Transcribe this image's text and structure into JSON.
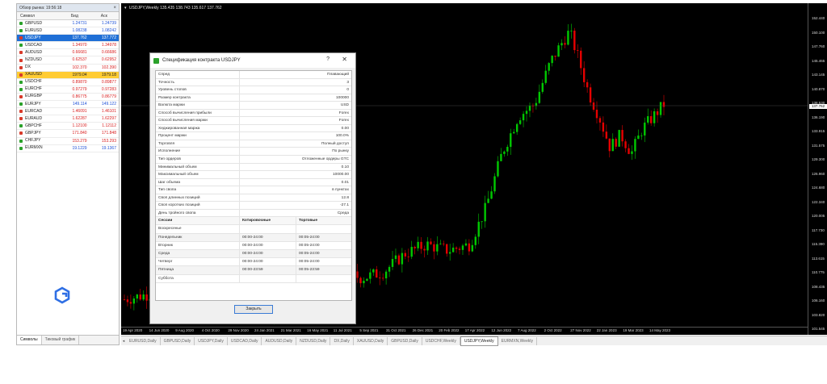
{
  "colors": {
    "bull": "#00c800",
    "bear": "#e60000",
    "selection": "#1f6fd6",
    "highlight": "#ffcc33"
  },
  "market_watch": {
    "title": "Обзор рынка: 19:56:18",
    "columns": [
      "Символ",
      "Бид",
      "Аск"
    ],
    "rows": [
      {
        "symbol": "GBPUSD",
        "bid": "1.24731",
        "ask": "1.24739",
        "color": "blue",
        "icon": "green"
      },
      {
        "symbol": "EURUSD",
        "bid": "1.08238",
        "ask": "1.08242",
        "color": "blue",
        "icon": "green"
      },
      {
        "symbol": "USDJPY",
        "bid": "137.762",
        "ask": "137.772",
        "color": "blue",
        "icon": "red",
        "state": "selected"
      },
      {
        "symbol": "USDCAD",
        "bid": "1.34970",
        "ask": "1.34978",
        "color": "red",
        "icon": "green"
      },
      {
        "symbol": "AUDUSD",
        "bid": "0.66681",
        "ask": "0.66686",
        "color": "red",
        "icon": "red"
      },
      {
        "symbol": "NZDUSD",
        "bid": "0.62537",
        "ask": "0.62952",
        "color": "red",
        "icon": "red"
      },
      {
        "symbol": "DX",
        "bid": "102.370",
        "ask": "102.390",
        "color": "red",
        "icon": "red"
      },
      {
        "symbol": "XAUUSD",
        "bid": "1979.04",
        "ask": "1979.18",
        "color": "red",
        "icon": "red",
        "state": "highlight"
      },
      {
        "symbol": "USDCHF",
        "bid": "0.89870",
        "ask": "0.89877",
        "color": "red",
        "icon": "green"
      },
      {
        "symbol": "EURCHF",
        "bid": "0.97279",
        "ask": "0.97283",
        "color": "red",
        "icon": "green"
      },
      {
        "symbol": "EURGBP",
        "bid": "0.86775",
        "ask": "0.86779",
        "color": "red",
        "icon": "red"
      },
      {
        "symbol": "EURJPY",
        "bid": "149.114",
        "ask": "149.122",
        "color": "blue",
        "icon": "green"
      },
      {
        "symbol": "EURCAD",
        "bid": "1.46091",
        "ask": "1.46101",
        "color": "red",
        "icon": "red"
      },
      {
        "symbol": "EURAUD",
        "bid": "1.62287",
        "ask": "1.62297",
        "color": "red",
        "icon": "red"
      },
      {
        "symbol": "GBPCHF",
        "bid": "1.12100",
        "ask": "1.12112",
        "color": "red",
        "icon": "green"
      },
      {
        "symbol": "GBPJPY",
        "bid": "171.840",
        "ask": "171.848",
        "color": "red",
        "icon": "red"
      },
      {
        "symbol": "CHFJPY",
        "bid": "153.279",
        "ask": "153.293",
        "color": "red",
        "icon": "green"
      },
      {
        "symbol": "EURMXN",
        "bid": "19.1229",
        "ask": "19.1367",
        "color": "blue",
        "icon": "green"
      }
    ],
    "tabs": [
      "Символы",
      "Тиковый график"
    ]
  },
  "chart": {
    "info": "USDJPY,Weekly  135.435  138.743  135.617  137.762",
    "current_price": "137.762",
    "price_labels": [
      "152.440",
      "150.100",
      "147.760",
      "145.465",
      "143.145",
      "140.870",
      "138.530",
      "136.190",
      "133.915",
      "131.575",
      "129.300",
      "126.960",
      "124.680",
      "122.340",
      "120.005",
      "117.730",
      "115.390",
      "113.615",
      "110.775",
      "108.435",
      "106.160",
      "103.820",
      "101.545"
    ],
    "time_labels": [
      "19 Apr 2020",
      "14 Jun 2020",
      "9 Aug 2020",
      "4 Oct 2020",
      "29 Nov 2020",
      "24 Jan 2021",
      "21 Mar 2021",
      "16 May 2021",
      "11 Jul 2021",
      "5 Sep 2021",
      "31 Oct 2021",
      "26 Dec 2021",
      "20 Feb 2022",
      "17 Apr 2022",
      "12 Jun 2022",
      "7 Aug 2022",
      "2 Oct 2022",
      "27 Nov 2022",
      "22 Jan 2023",
      "19 Mar 2023",
      "14 May 2023"
    ],
    "tabs": [
      "EURUSD,Daily",
      "GBPUSD,Daily",
      "USDJPY,Daily",
      "USDCAD,Daily",
      "AUDUSD,Daily",
      "NZDUSD,Daily",
      "DX,Daily",
      "XAUUSD,Daily",
      "GBPUSD,Daily",
      "USDCHF,Weekly",
      "USDJPY,Weekly",
      "EURMXN,Weekly"
    ],
    "active_tab": 10
  },
  "dialog": {
    "title": "Спецификация контракта USDJPY",
    "help": "?",
    "close_x": "✕",
    "specs": [
      {
        "k": "Спред",
        "v": "Плавающий"
      },
      {
        "k": "Точность",
        "v": "3"
      },
      {
        "k": "Уровень стопов",
        "v": "0"
      },
      {
        "k": "Размер контракта",
        "v": "100000"
      },
      {
        "k": "Валюта маржи",
        "v": "USD"
      },
      {
        "k": "Способ вычисления прибыли",
        "v": "Forex"
      },
      {
        "k": "Способ вычисления маржи",
        "v": "Forex"
      },
      {
        "k": "Хеджированная маржа",
        "v": "0.00"
      },
      {
        "k": "Процент маржи",
        "v": "100.0%"
      },
      {
        "k": "Торговля",
        "v": "Полный доступ"
      },
      {
        "k": "Исполнение",
        "v": "По рынку"
      },
      {
        "k": "Тип ордеров",
        "v": "Отложенные ордеры GTC"
      },
      {
        "k": "Минимальный объем",
        "v": "0.10"
      },
      {
        "k": "Максимальный объем",
        "v": "10000.00"
      },
      {
        "k": "Шаг объема",
        "v": "0.01"
      },
      {
        "k": "Тип свопа",
        "v": "в пунктах"
      },
      {
        "k": "Своп длинных позиций",
        "v": "12.8"
      },
      {
        "k": "Своп коротких позиций",
        "v": "-27.1"
      },
      {
        "k": "День тройного свопа",
        "v": "Среда"
      }
    ],
    "sessions_header": [
      "Сессии",
      "Котировочные",
      "Торговые"
    ],
    "sessions": [
      {
        "day": "Воскресенье",
        "quote": "",
        "trade": ""
      },
      {
        "day": "Понедельник",
        "quote": "00:00-24:00",
        "trade": "00:05-24:00"
      },
      {
        "day": "Вторник",
        "quote": "00:00-24:00",
        "trade": "00:05-24:00"
      },
      {
        "day": "Среда",
        "quote": "00:00-24:00",
        "trade": "00:05-24:00"
      },
      {
        "day": "Четверг",
        "quote": "00:00-24:00",
        "trade": "00:05-24:00"
      },
      {
        "day": "Пятница",
        "quote": "00:00-23:59",
        "trade": "00:05-23:59"
      },
      {
        "day": "Суббота",
        "quote": "",
        "trade": ""
      }
    ],
    "close_button": "Закрыть"
  }
}
